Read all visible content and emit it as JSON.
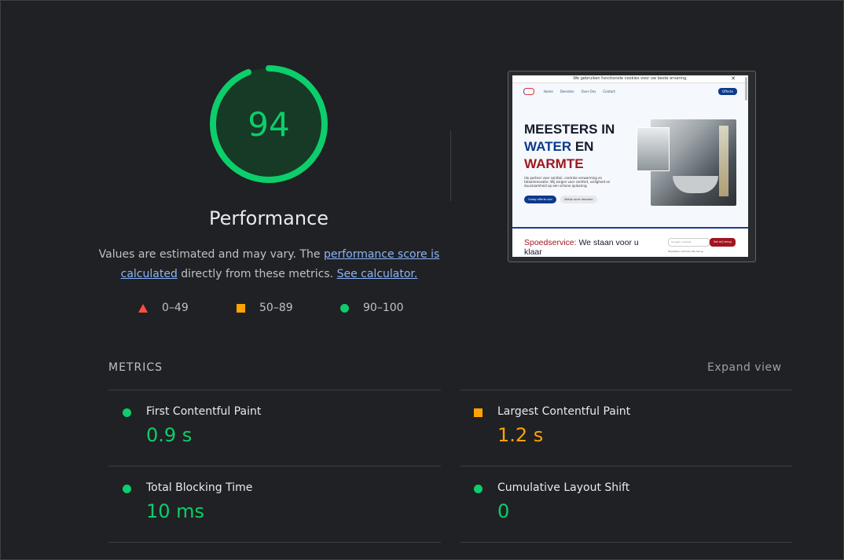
{
  "score": {
    "value": "94",
    "fraction": 0.94,
    "title": "Performance",
    "description_before": "Values are estimated and may vary. The ",
    "link_score": "performance score is calculated",
    "description_middle": " directly from these metrics. ",
    "link_calculator": "See calculator.",
    "color": "#0cce6b"
  },
  "legend": [
    {
      "label": "0–49",
      "shape": "triangle",
      "color": "#ff4e42"
    },
    {
      "label": "50–89",
      "shape": "square",
      "color": "#ffa400"
    },
    {
      "label": "90–100",
      "shape": "circle",
      "color": "#0cce6b"
    }
  ],
  "screenshot": {
    "cookie_text": "We gebruiken functionele cookies voor uw beste ervaring.",
    "close": "✕",
    "nav": [
      "Home",
      "Diensten",
      "Over Ons",
      "Contact"
    ],
    "nav_cta": "Offerte",
    "heading_l1": "MEESTERS IN",
    "heading_l2a": "WATER",
    "heading_l2b": " EN",
    "heading_l3": "WARMTE",
    "paragraph": "Uw partner voor sanitair, centrale verwarming en totaalrenovatie. Wij zorgen voor comfort, veiligheid en duurzaamheid op een schone oplossing.",
    "btn_primary": "Vraag offerte aan",
    "btn_secondary": "Bekijk onze diensten",
    "band_title_accent": "Spoedservice:",
    "band_title_rest": " We staan voor u klaar",
    "band_input_placeholder": "Uw gsm nummer",
    "band_button": "Bel mij terug",
    "band_small": "Wij bellen u binnen 24u terug"
  },
  "metrics": {
    "header": "METRICS",
    "expand": "Expand view",
    "items": [
      {
        "name": "First Contentful Paint",
        "value": "0.9 s",
        "status": "pass"
      },
      {
        "name": "Largest Contentful Paint",
        "value": "1.2 s",
        "status": "average"
      },
      {
        "name": "Total Blocking Time",
        "value": "10 ms",
        "status": "pass"
      },
      {
        "name": "Cumulative Layout Shift",
        "value": "0",
        "status": "pass"
      }
    ]
  }
}
